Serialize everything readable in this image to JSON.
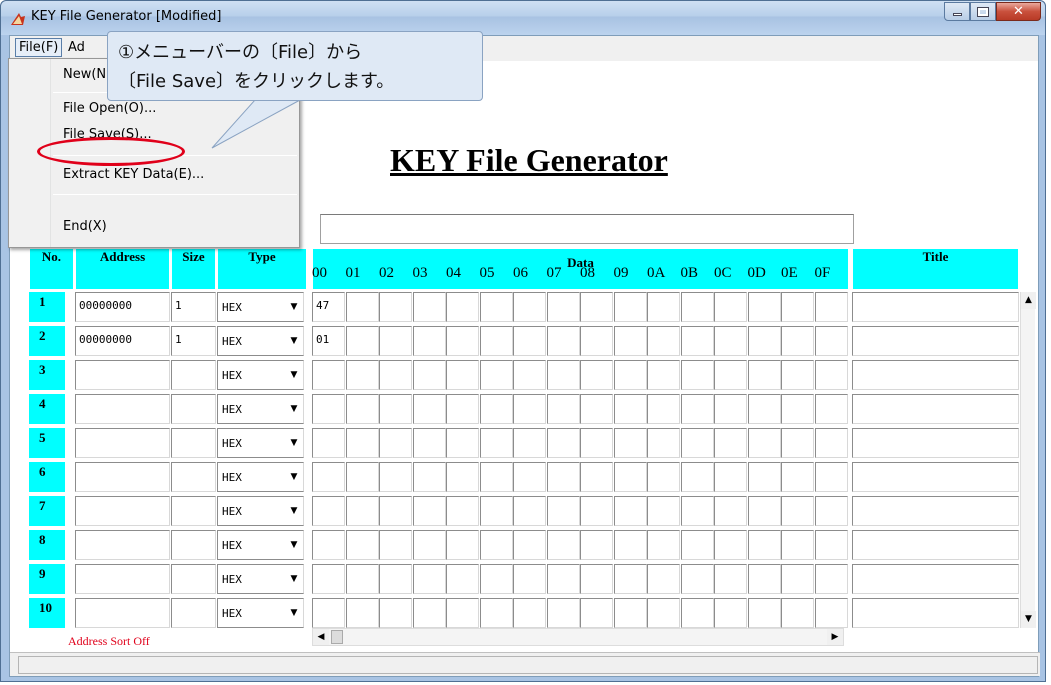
{
  "window": {
    "title": "KEY File Generator [Modified]"
  },
  "menubar": {
    "file": "File(F)",
    "add": "Ad"
  },
  "menu": {
    "items": [
      "New(N",
      "File Open(O)...",
      "File Save(S)...",
      "Extract KEY Data(E)...",
      "End(X)"
    ]
  },
  "callout": {
    "line1": "①メニューバーの〔File〕から",
    "line2": "〔File Save〕をクリックします。"
  },
  "main": {
    "title": "KEY File Generator",
    "headers": {
      "no": "No.",
      "address": "Address",
      "size": "Size",
      "type": "Type",
      "data": "Data",
      "title": "Title"
    },
    "data_columns": [
      "00",
      "01",
      "02",
      "03",
      "04",
      "05",
      "06",
      "07",
      "08",
      "09",
      "0A",
      "0B",
      "0C",
      "0D",
      "0E",
      "0F"
    ],
    "rows": [
      {
        "no": "1",
        "address": "00000000",
        "size": "1",
        "type": "HEX",
        "data": [
          "47",
          "",
          "",
          "",
          "",
          "",
          "",
          "",
          "",
          "",
          "",
          "",
          "",
          "",
          "",
          ""
        ],
        "title": ""
      },
      {
        "no": "2",
        "address": "00000000",
        "size": "1",
        "type": "HEX",
        "data": [
          "01",
          "",
          "",
          "",
          "",
          "",
          "",
          "",
          "",
          "",
          "",
          "",
          "",
          "",
          "",
          ""
        ],
        "title": ""
      },
      {
        "no": "3",
        "address": "",
        "size": "",
        "type": "HEX",
        "data": [],
        "title": ""
      },
      {
        "no": "4",
        "address": "",
        "size": "",
        "type": "HEX",
        "data": [],
        "title": ""
      },
      {
        "no": "5",
        "address": "",
        "size": "",
        "type": "HEX",
        "data": [],
        "title": ""
      },
      {
        "no": "6",
        "address": "",
        "size": "",
        "type": "HEX",
        "data": [],
        "title": ""
      },
      {
        "no": "7",
        "address": "",
        "size": "",
        "type": "HEX",
        "data": [],
        "title": ""
      },
      {
        "no": "8",
        "address": "",
        "size": "",
        "type": "HEX",
        "data": [],
        "title": ""
      },
      {
        "no": "9",
        "address": "",
        "size": "",
        "type": "HEX",
        "data": [],
        "title": ""
      },
      {
        "no": "10",
        "address": "",
        "size": "",
        "type": "HEX",
        "data": [],
        "title": ""
      }
    ],
    "sort_status": "Address Sort Off"
  },
  "icons": {
    "app": "app-icon",
    "minimize": "minimize-icon",
    "maximize": "maximize-icon",
    "close": "close-icon",
    "dropdown_arrow": "chevron-down-icon",
    "scroll_up": "arrow-up-icon",
    "scroll_down": "arrow-down-icon",
    "scroll_left": "arrow-left-icon",
    "scroll_right": "arrow-right-icon"
  },
  "colors": {
    "header_cyan": "#00ffff",
    "highlight_red": "#e0001a",
    "callout_bg": "#dfe9f5"
  }
}
